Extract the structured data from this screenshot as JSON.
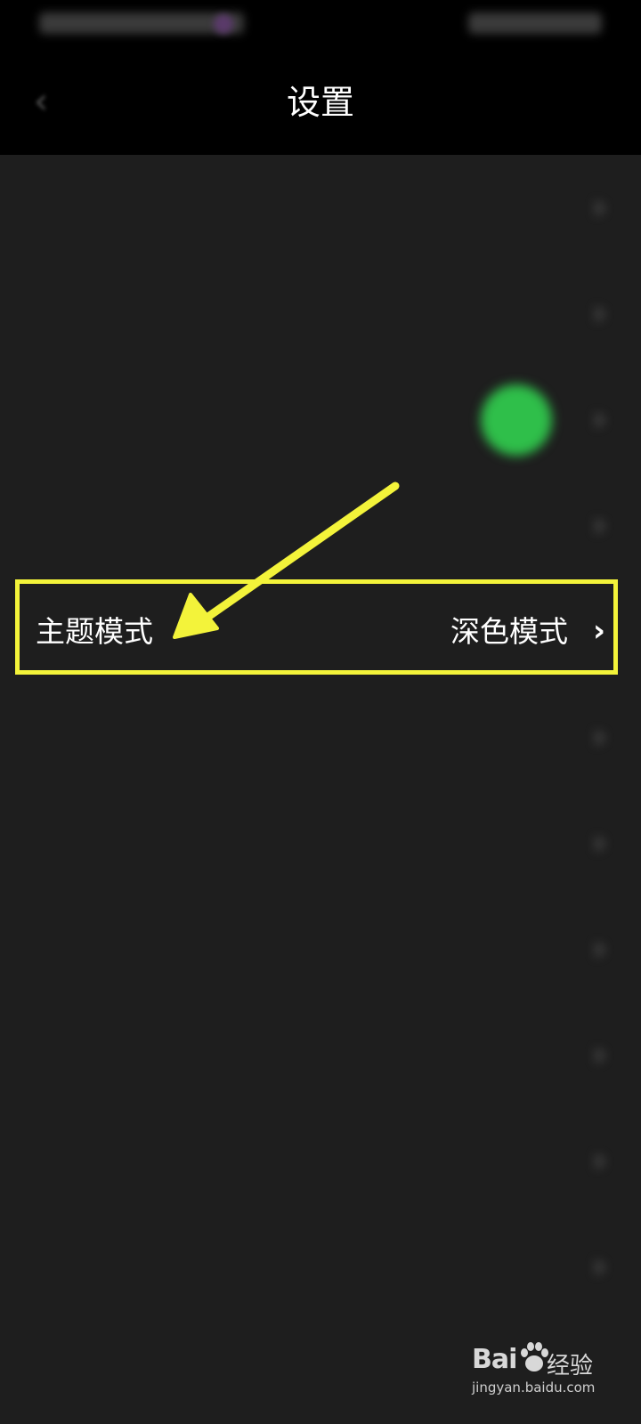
{
  "header": {
    "title": "设置"
  },
  "settings": {
    "rows": [
      {
        "label": "",
        "value": "",
        "has_avatar": false
      },
      {
        "label": "",
        "value": "",
        "has_avatar": false
      },
      {
        "label": "",
        "value": "",
        "has_avatar": true
      },
      {
        "label": "",
        "value": "",
        "has_avatar": false
      },
      {
        "label": "主题模式",
        "value": "深色模式",
        "has_avatar": false
      },
      {
        "label": "",
        "value": "",
        "has_avatar": false
      },
      {
        "label": "",
        "value": "",
        "has_avatar": false
      },
      {
        "label": "",
        "value": "",
        "has_avatar": false
      },
      {
        "label": "",
        "value": "",
        "has_avatar": false
      },
      {
        "label": "",
        "value": "",
        "has_avatar": false
      },
      {
        "label": "",
        "value": "",
        "has_avatar": false
      },
      {
        "label": "",
        "value": "",
        "has_avatar": false
      }
    ],
    "chevron": "›"
  },
  "annotation": {
    "color": "#f3f33a"
  },
  "watermark": {
    "brand": "Bai",
    "brand_suffix": "经验",
    "url": "jingyan.baidu.com"
  },
  "colors": {
    "background": "#1e1e1e",
    "header_background": "#000000",
    "avatar": "#2fbf4a",
    "highlight_border": "#f3f33a"
  },
  "icons": {
    "back": "chevron-left-icon",
    "chevron": "chevron-right-icon"
  }
}
